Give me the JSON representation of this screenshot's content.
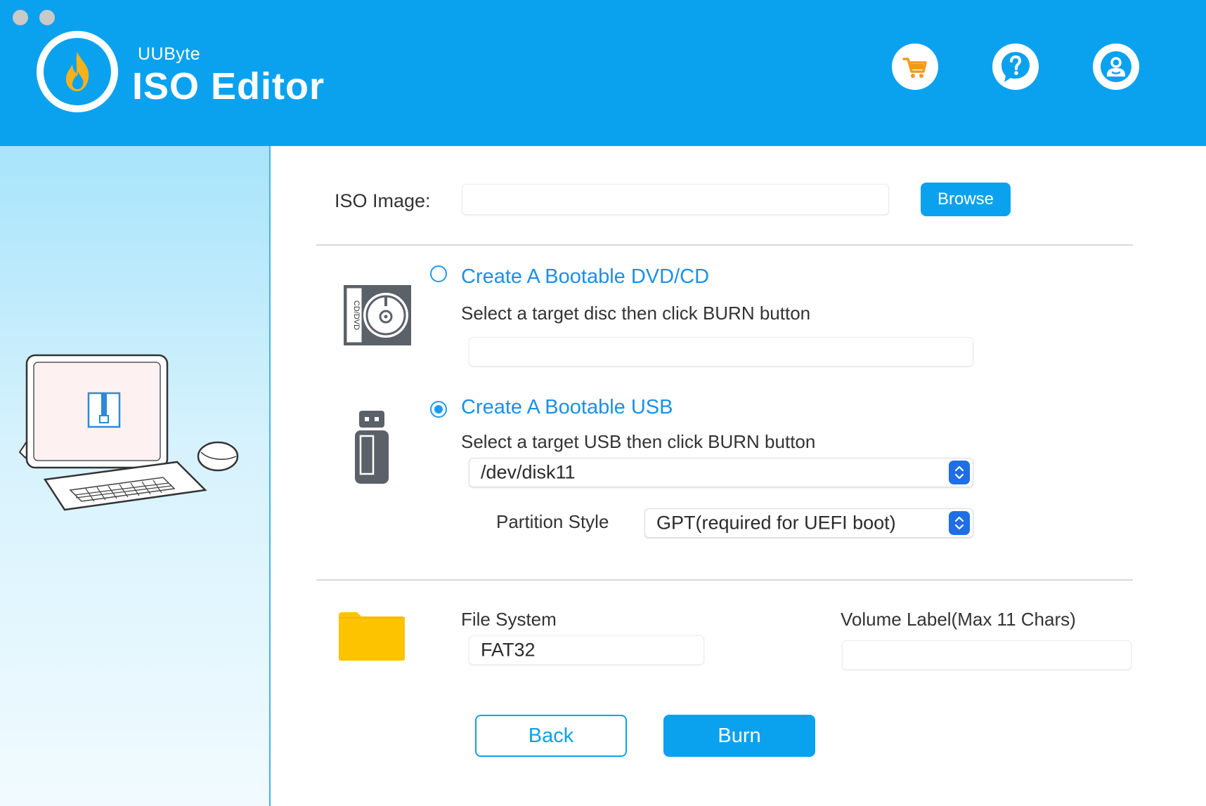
{
  "app": {
    "brand_small": "UUByte",
    "brand_name": "ISO Editor"
  },
  "header_icons": [
    "cart-icon",
    "help-icon",
    "user-icon"
  ],
  "iso": {
    "label": "ISO Image:",
    "value": "",
    "browse_label": "Browse"
  },
  "dvd": {
    "title": "Create A Bootable DVD/CD",
    "instruction": "Select a target disc then click BURN button",
    "selected": false,
    "disc_value": "",
    "icon_text": "CD/DVD"
  },
  "usb": {
    "title": "Create A Bootable USB",
    "instruction": "Select a target USB then click BURN button",
    "selected": true,
    "device": "/dev/disk11",
    "partition_label": "Partition Style",
    "partition_value": "GPT(required for UEFI boot)"
  },
  "fs": {
    "label": "File System",
    "value": "FAT32",
    "volume_label": "Volume Label(Max 11 Chars)",
    "volume_value": ""
  },
  "actions": {
    "back_label": "Back",
    "burn_label": "Burn"
  },
  "colors": {
    "header": "#0aa2ee",
    "accent": "#1d8fe6",
    "cart": "#f39a1c",
    "folder": "#fec300"
  }
}
